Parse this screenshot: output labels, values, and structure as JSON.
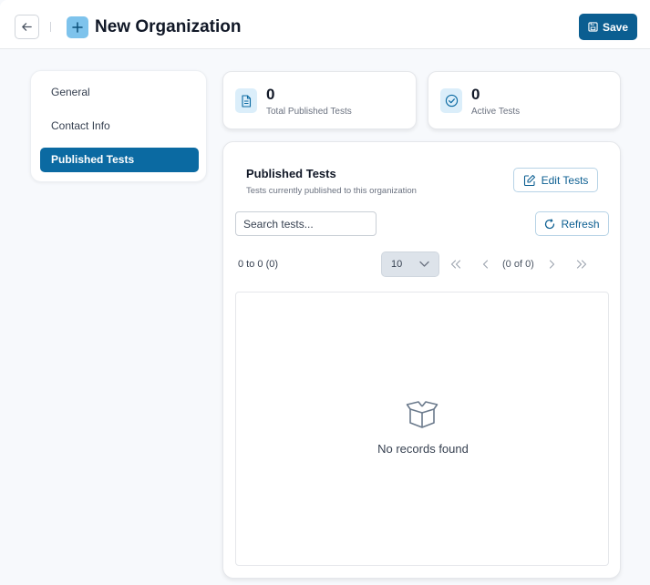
{
  "header": {
    "title": "New Organization",
    "save_label": "Save",
    "back_icon": "arrow-left-icon",
    "title_icon": "plus-icon"
  },
  "sidebar": {
    "items": [
      {
        "label": "General"
      },
      {
        "label": "Contact Info"
      },
      {
        "label": "Published Tests",
        "active": true
      }
    ]
  },
  "stats": [
    {
      "value": "0",
      "label": "Total Published Tests",
      "icon": "document-icon"
    },
    {
      "value": "0",
      "label": "Active Tests",
      "icon": "check-circle-icon"
    }
  ],
  "section": {
    "title": "Published Tests",
    "subtitle": "Tests currently published to this organization",
    "edit_label": "Edit Tests",
    "refresh_label": "Refresh",
    "search_placeholder": "Search tests...",
    "range_text": "0 to 0 (0)",
    "page_size": "10",
    "page_info": "(0 of 0)",
    "empty_text": "No records found"
  },
  "colors": {
    "primary": "#0b5e91",
    "active_nav": "#0b6aa2",
    "icon_bg": "#dbeefa",
    "title_icon_bg": "#7ec3ec"
  }
}
